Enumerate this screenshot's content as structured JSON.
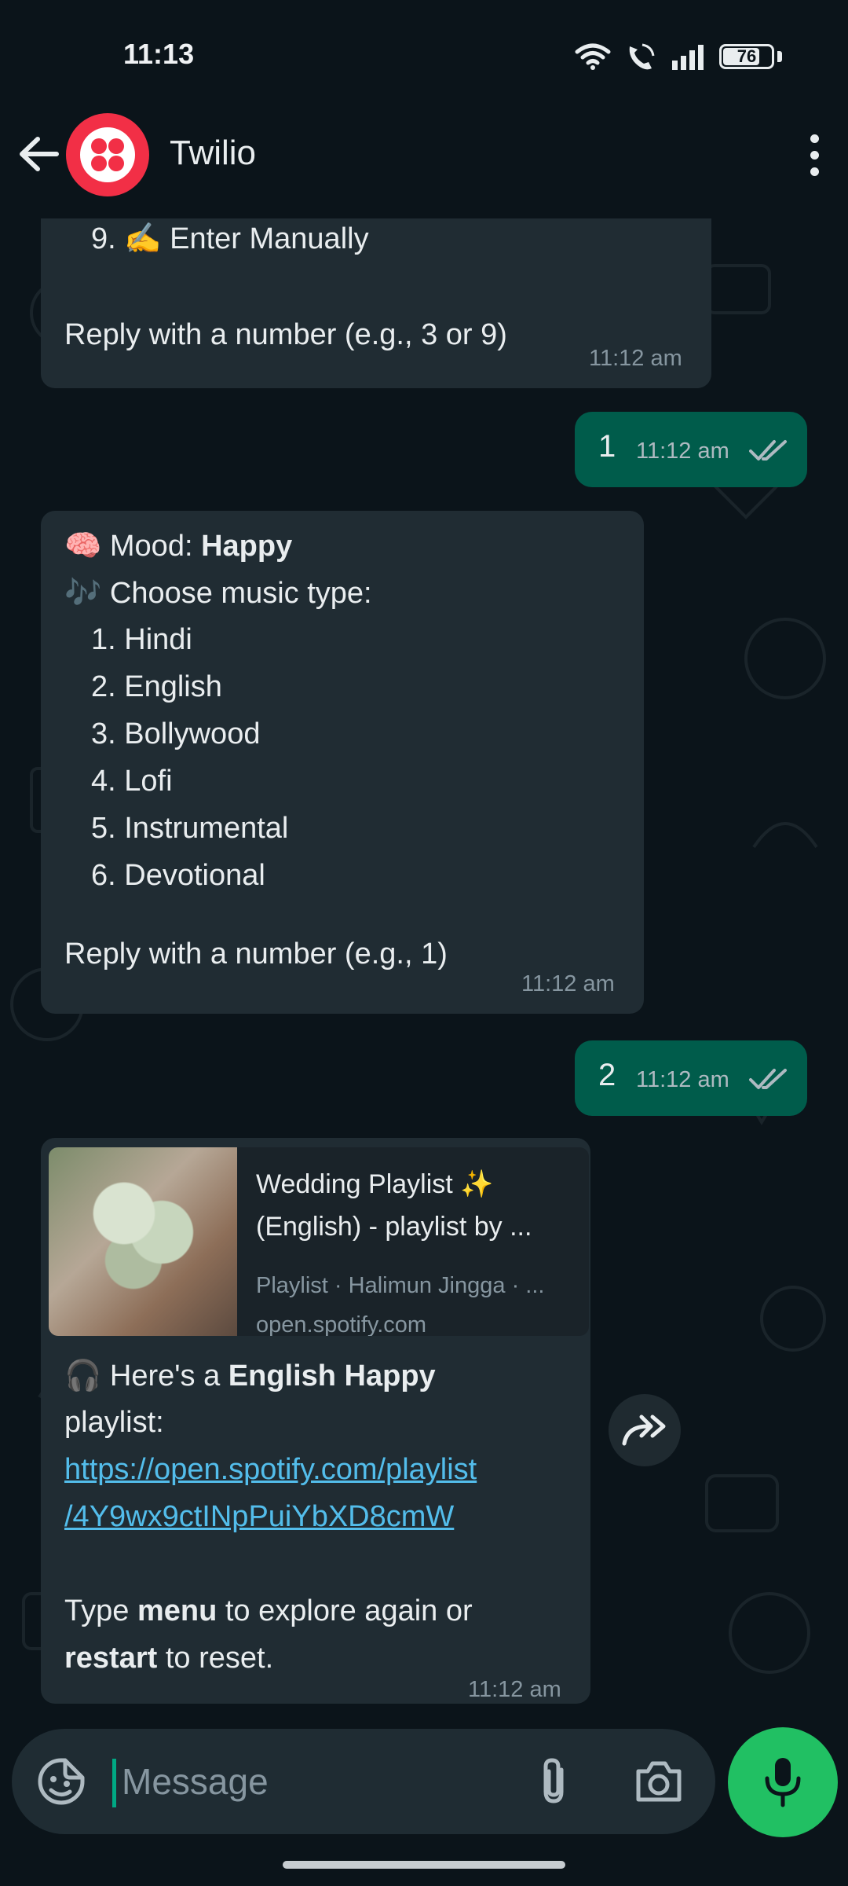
{
  "status_bar": {
    "time": "11:13",
    "battery": "76"
  },
  "header": {
    "contact_name": "Twilio"
  },
  "messages": {
    "m1": {
      "item_9": "9. ✍️ Enter Manually",
      "reply_hint": "Reply with a number (e.g., 3 or 9)",
      "time": "11:12 am"
    },
    "m2": {
      "text": "1",
      "time": "11:12 am"
    },
    "m3": {
      "mood_emoji": "🧠",
      "mood_label": "Mood: ",
      "mood_value": "Happy",
      "choose_emoji": "🎶",
      "choose_label": "Choose music type:",
      "options": [
        "1. Hindi",
        "2. English",
        "3. Bollywood",
        "4. Lofi",
        "5. Instrumental",
        "6. Devotional"
      ],
      "reply_hint": "Reply with a number (e.g., 1)",
      "time": "11:12 am"
    },
    "m4": {
      "text": "2",
      "time": "11:12 am"
    },
    "m5": {
      "preview_title_1": "Wedding Playlist ✨",
      "preview_title_2": "(English) - playlist by ...",
      "preview_sub": "Playlist · Halimun Jingga · ...",
      "preview_domain": "open.spotify.com",
      "headphone_emoji": "🎧",
      "here_text": "Here's a ",
      "highlight": "English Happy",
      "playlist_word": "playlist:",
      "link_1": "https://open.spotify.com/playlist",
      "link_2": "/4Y9wx9ctINpPuiYbXD8cmW",
      "type_text": "Type ",
      "menu_word": "menu",
      "explore_text": " to explore again or",
      "restart_word": "restart",
      "reset_text": " to reset.",
      "time": "11:12 am"
    }
  },
  "input": {
    "placeholder": "Message"
  },
  "colors": {
    "background": "#0b141a",
    "incoming_bubble": "#202c33",
    "outgoing_bubble": "#005c4b",
    "link": "#53bdeb",
    "mic_button": "#21c063",
    "read_ticks": "#aebac1"
  },
  "icons": {
    "back": "arrow-left-icon",
    "menu": "more-vertical-icon",
    "forward": "forward-icon",
    "emoji": "sticker-emoji-icon",
    "attach": "paperclip-icon",
    "camera": "camera-icon",
    "mic": "microphone-icon"
  }
}
